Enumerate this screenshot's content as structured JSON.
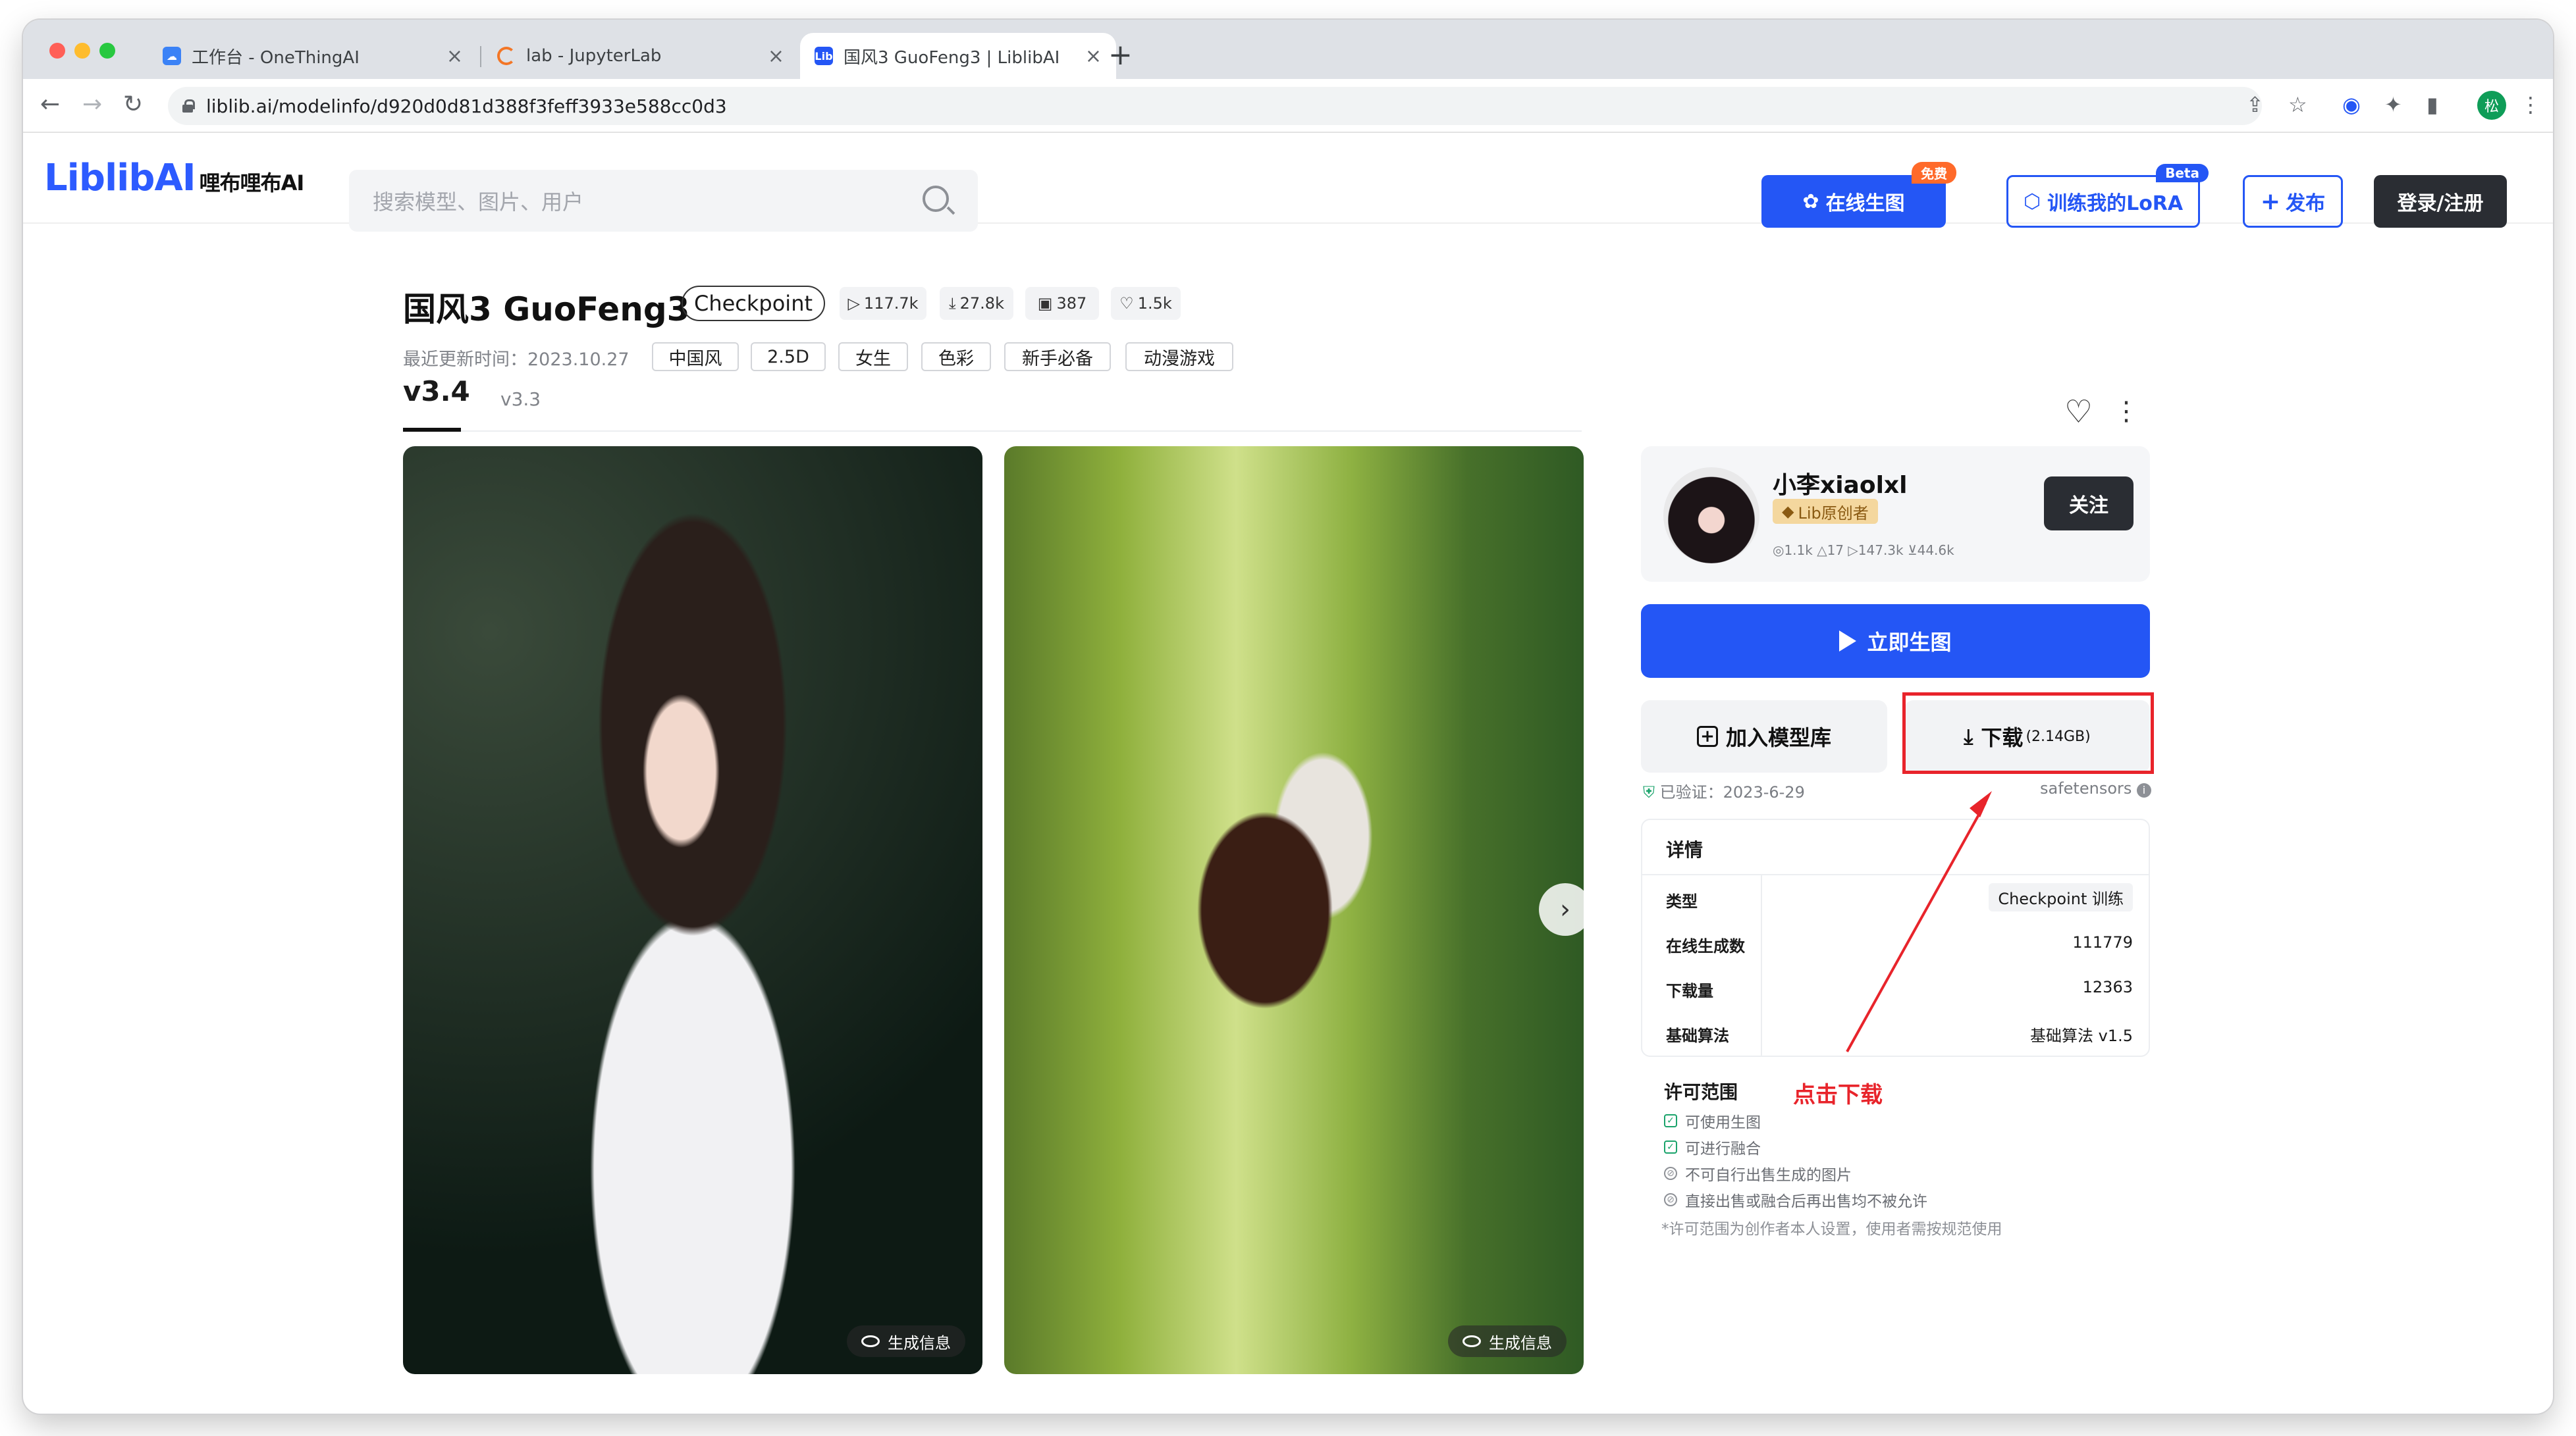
{
  "browser": {
    "tabs": [
      {
        "title": "工作台 - OneThingAI",
        "close": "×"
      },
      {
        "title": "lab - JupyterLab",
        "close": "×"
      },
      {
        "title": "国风3 GuoFeng3 | LiblibAI",
        "close": "×",
        "favicon": "Lib"
      }
    ],
    "new_tab": "+",
    "nav": {
      "back": "←",
      "forward": "→",
      "reload": "↻"
    },
    "url": "liblib.ai/modelinfo/d920d0d81d388f3feff3933e588cc0d3",
    "toolbar_icons": {
      "share": "⇪",
      "star": "☆",
      "ext1": "◉",
      "puzzle": "✦",
      "sidebar": "▮",
      "menu": "⋮"
    },
    "profile_initial": "松"
  },
  "site": {
    "logo": "LiblibAI",
    "logo_cn": "哩布哩布AI",
    "search_placeholder": "搜索模型、图片、用户",
    "btn_online": "在线生图",
    "badge_free": "免费",
    "btn_train": "训练我的LoRA",
    "badge_beta": "Beta",
    "btn_publish": "发布",
    "btn_login": "登录/注册"
  },
  "model": {
    "title": "国风3 GuoFeng3",
    "type_pill": "Checkpoint",
    "stats": {
      "runs": "117.7k",
      "downloads": "27.8k",
      "images": "387",
      "likes": "1.5k"
    },
    "updated": "最近更新时间：2023.10.27",
    "tags": [
      "中国风",
      "2.5D",
      "女生",
      "色彩",
      "新手必备",
      "动漫游戏"
    ],
    "versions": [
      "v3.4",
      "v3.3"
    ],
    "gen_info": "生成信息"
  },
  "author": {
    "name": "小李xiaolxl",
    "badge": "Lib原创者",
    "stats": "◎1.1k  △17  ▷147.3k  ⊻44.6k",
    "follow": "关注"
  },
  "actions": {
    "generate": "立即生图",
    "add_library": "加入模型库",
    "download": "下载",
    "download_size": "(2.14GB)",
    "verified": "已验证：2023-6-29",
    "format": "safetensors"
  },
  "details": {
    "header": "详情",
    "rows": [
      {
        "key": "类型",
        "value": "Checkpoint 训练"
      },
      {
        "key": "在线生成数",
        "value": "111779"
      },
      {
        "key": "下载量",
        "value": "12363"
      },
      {
        "key": "基础算法",
        "value": "基础算法 v1.5"
      }
    ]
  },
  "license": {
    "title": "许可范围",
    "allowed": [
      "可使用生图",
      "可进行融合"
    ],
    "denied": [
      "不可自行出售生成的图片",
      "直接出售或融合后再出售均不被允许"
    ],
    "note": "*许可范围为创作者本人设置，使用者需按规范使用"
  },
  "annotation": {
    "text": "点击下载",
    "color": "#e8242b"
  },
  "colors": {
    "primary": "#2456f5",
    "dark": "#2a2d33",
    "accent_red": "#e8242b"
  }
}
